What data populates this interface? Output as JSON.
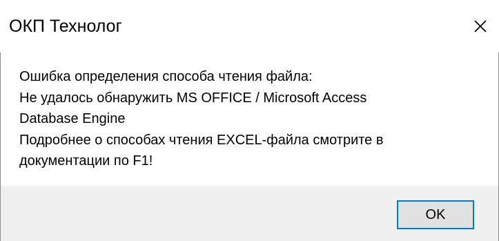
{
  "window": {
    "title": "ОКП Технолог",
    "close_icon": "close-icon"
  },
  "message": {
    "lines": [
      "Ошибка определения способа чтения файла:",
      "Не удалось обнаружить MS OFFICE / Microsoft Access",
      "Database Engine",
      "Подробнее о способах чтения EXCEL-файла смотрите в",
      "документации по F1!"
    ]
  },
  "buttons": {
    "ok_label": "OK"
  },
  "colors": {
    "accent": "#0078d7",
    "footer_bg": "#f0f0f0",
    "button_bg": "#e1e1e1"
  }
}
